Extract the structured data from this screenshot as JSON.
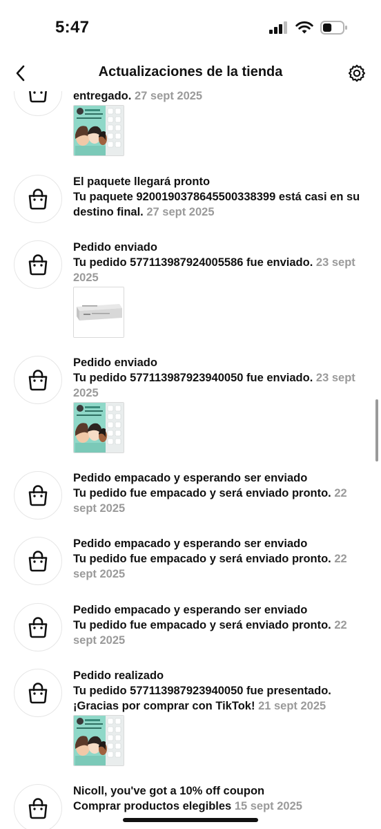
{
  "status_bar": {
    "time": "5:47",
    "battery_level": 0.45
  },
  "nav": {
    "title": "Actualizaciones de la tienda",
    "back_icon": "chevron-left-icon",
    "settings_icon": "gear-icon"
  },
  "colors": {
    "text": "#111111",
    "date": "#9a9a9a",
    "avatar_border": "#e6e6e6",
    "thumb_teal": "#7fd3c3"
  },
  "items": [
    {
      "title": "",
      "body": "entregado.",
      "date": "27 sept 2025",
      "icon": "shopping-bag-icon",
      "thumbnail": "acne-patch-product"
    },
    {
      "title": "El paquete llegará pronto",
      "body": "Tu paquete 9200190378645500338399 está casi en su destino final.",
      "date": "27 sept 2025",
      "icon": "shopping-bag-icon"
    },
    {
      "title": "Pedido enviado",
      "body": "Tu pedido 577113987924005586 fue enviado.",
      "date": "23 sept 2025",
      "icon": "shopping-bag-icon",
      "thumbnail": "product-box"
    },
    {
      "title": "Pedido enviado",
      "body": "Tu pedido 577113987923940050 fue enviado.",
      "date": "23 sept 2025",
      "icon": "shopping-bag-icon",
      "thumbnail": "acne-patch-product"
    },
    {
      "title": "Pedido empacado y esperando ser enviado",
      "body": "Tu pedido fue empacado y será enviado pronto.",
      "date": "22 sept 2025",
      "icon": "shopping-bag-icon"
    },
    {
      "title": "Pedido empacado y esperando ser enviado",
      "body": "Tu pedido fue empacado y será enviado pronto.",
      "date": "22 sept 2025",
      "icon": "shopping-bag-icon"
    },
    {
      "title": "Pedido empacado y esperando ser enviado",
      "body": "Tu pedido fue empacado y será enviado pronto.",
      "date": "22 sept 2025",
      "icon": "shopping-bag-icon"
    },
    {
      "title": "Pedido realizado",
      "body": "Tu pedido 577113987923940050 fue presentado. ¡Gracias por comprar con TikTok!",
      "date": "21 sept 2025",
      "icon": "shopping-bag-icon",
      "thumbnail": "acne-patch-product"
    },
    {
      "title": "Nicoll, you've got a 10% off coupon",
      "body": "Comprar productos elegibles",
      "date": "15 sept 2025",
      "icon": "shopping-bag-icon"
    }
  ]
}
